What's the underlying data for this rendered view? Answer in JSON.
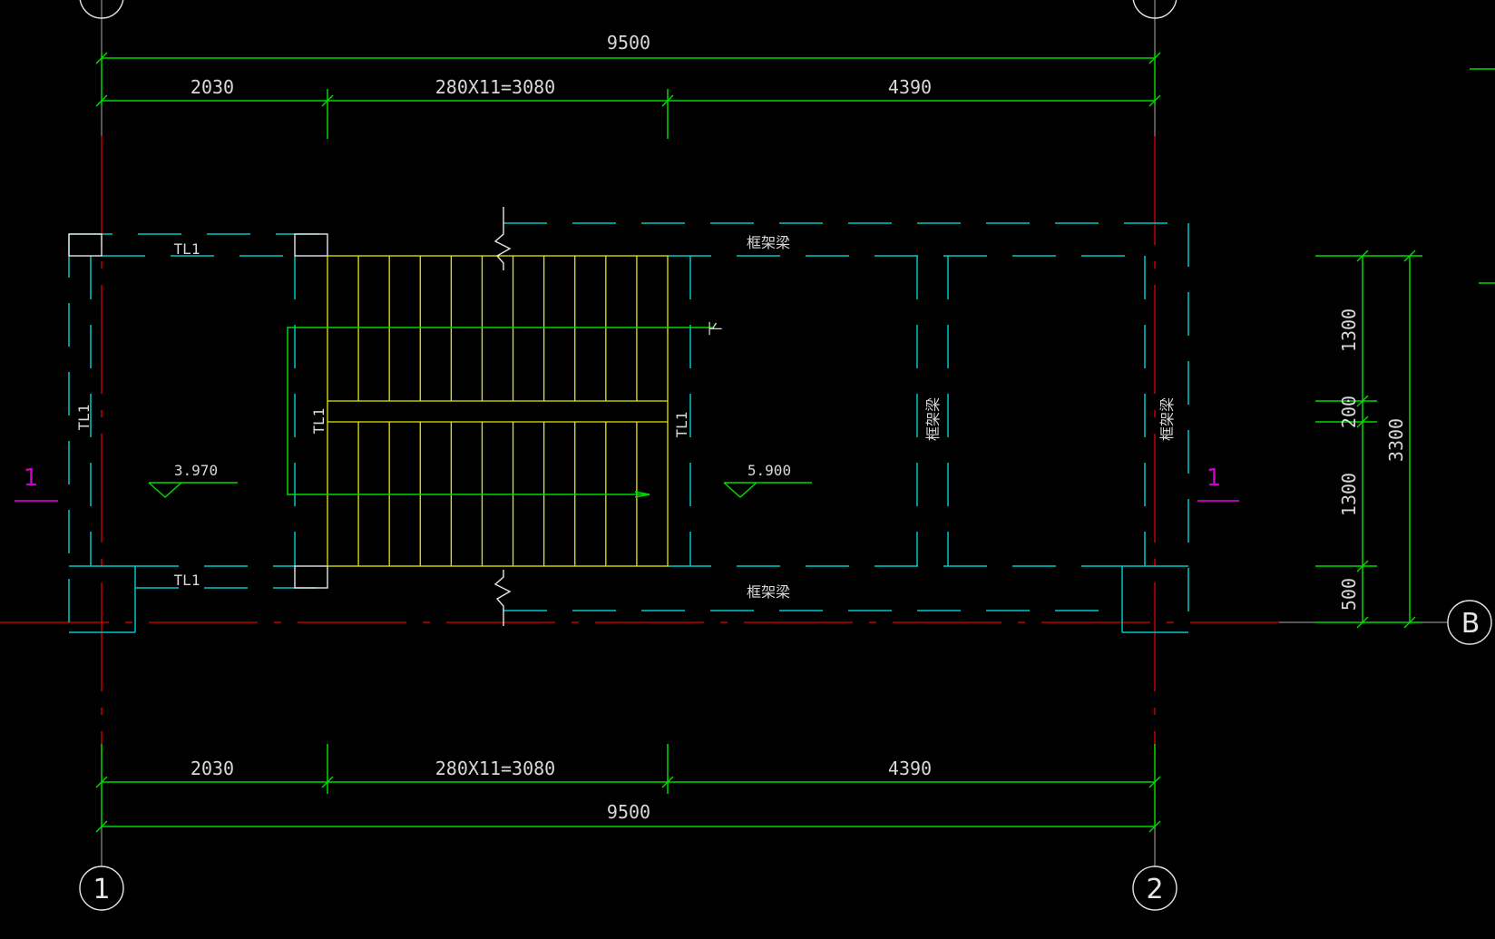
{
  "drawing": {
    "dimensions": {
      "top_total": "9500",
      "top_seg_left": "2030",
      "top_seg_mid": "280X11=3080",
      "top_seg_right": "4390",
      "bottom_total": "9500",
      "bottom_seg_left": "2030",
      "bottom_seg_mid": "280X11=3080",
      "bottom_seg_right": "4390",
      "right_seg_1": "1300",
      "right_seg_2": "200",
      "right_seg_3": "1300",
      "right_seg_4": "500",
      "right_total": "3300"
    },
    "labels": {
      "beam_tl1_top": "TL1",
      "beam_tl1_bottom": "TL1",
      "beam_tl1_left": "TL1",
      "beam_tl1_mid_left": "TL1",
      "beam_tl1_mid_right": "TL1",
      "frame_beam_top": "框架梁",
      "frame_beam_bottom": "框架梁",
      "frame_beam_mid": "框架梁",
      "frame_beam_right": "框架梁",
      "down_arrow_label": "下",
      "elevation_left": "3.970",
      "elevation_right": "5.900",
      "section_left": "1",
      "section_right": "1"
    },
    "axes": {
      "axis_1": "1",
      "axis_2": "2",
      "axis_b": "B"
    },
    "colors": {
      "background": "#000000",
      "dimension": "#00d800",
      "beam": "#00c8c8",
      "axis_line": "#e00000",
      "stair": "#e6e600",
      "section_mark": "#cc00cc",
      "text": "#d8d8d8"
    }
  }
}
